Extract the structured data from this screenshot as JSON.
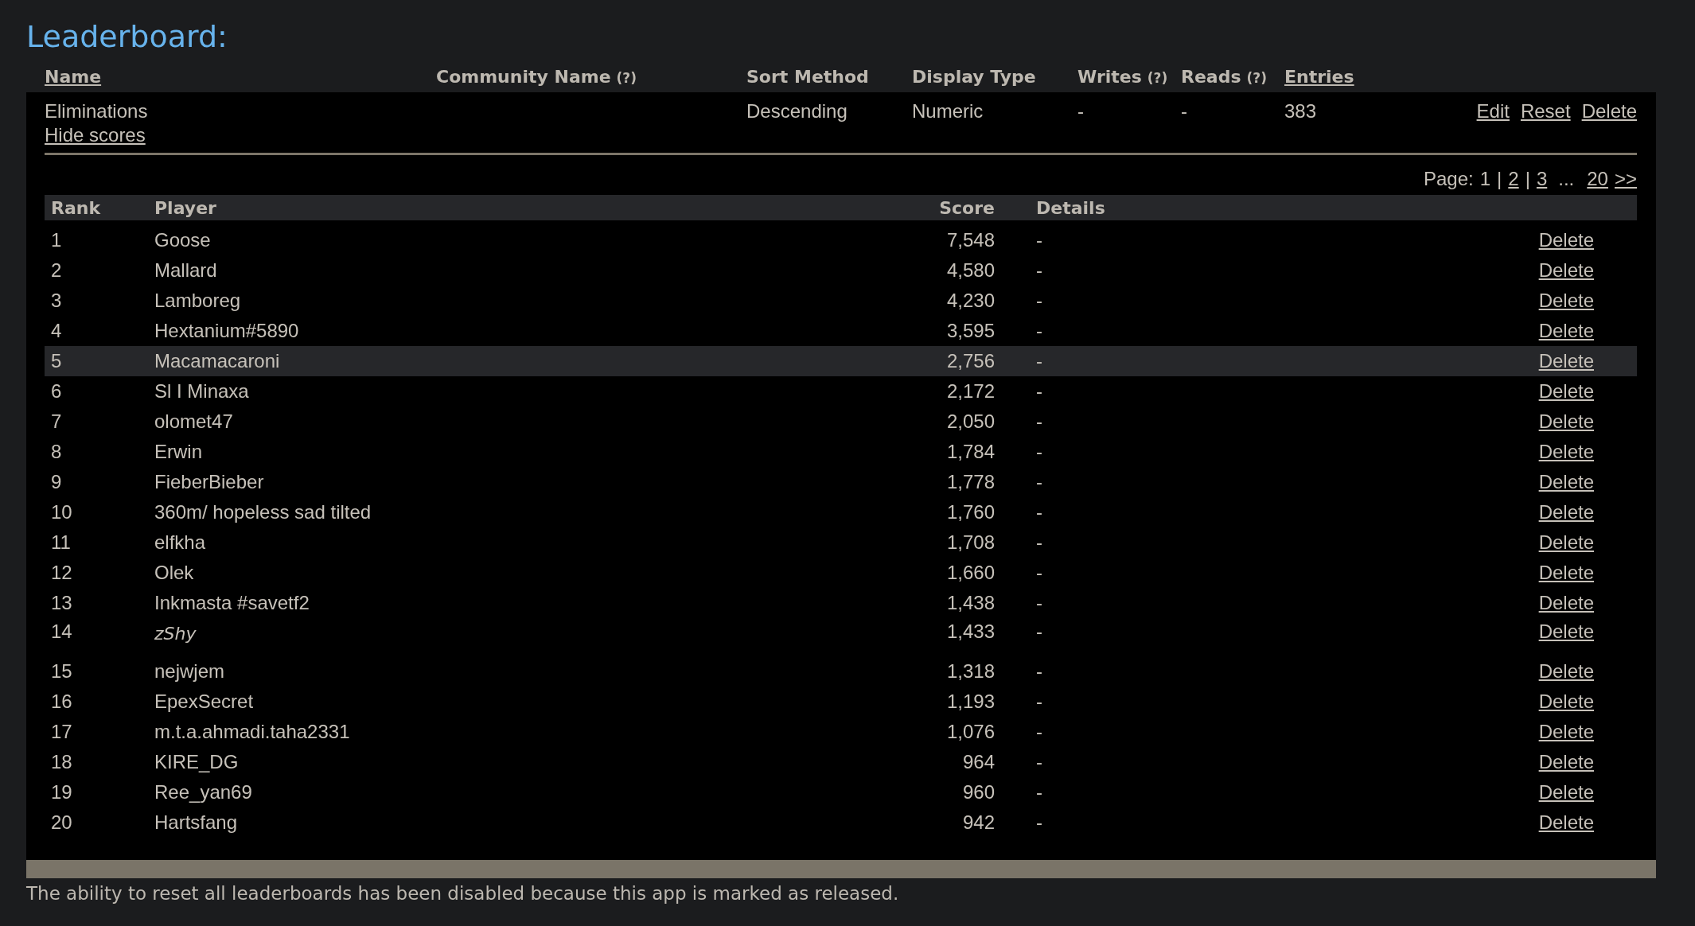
{
  "title": "Leaderboard:",
  "columns": [
    {
      "label": "Name",
      "link": true
    },
    {
      "label": "Community Name",
      "help": "(?)",
      "link": false
    },
    {
      "label": "Sort Method",
      "link": false
    },
    {
      "label": "Display Type",
      "link": false
    },
    {
      "label": "Writes",
      "help": "(?)",
      "link": false
    },
    {
      "label": "Reads",
      "help": "(?)",
      "link": false
    },
    {
      "label": "Entries",
      "link": true
    }
  ],
  "leaderboard": {
    "name": "Eliminations",
    "hide_link": "Hide scores",
    "sort_method": "Descending",
    "display_type": "Numeric",
    "writes": "-",
    "reads": "-",
    "entries": "383",
    "actions": [
      "Edit",
      "Reset",
      "Delete"
    ]
  },
  "pagination": {
    "label": "Page:",
    "current": "1",
    "separator": "|",
    "pages": [
      "2",
      "3"
    ],
    "ellipsis": "...",
    "last": "20",
    "next": ">>"
  },
  "score_columns": [
    "Rank",
    "Player",
    "Score",
    "Details"
  ],
  "rows": [
    {
      "rank": "1",
      "player": "Goose",
      "score": "7,548",
      "details": "-",
      "action": "Delete",
      "selected": false,
      "italic": false
    },
    {
      "rank": "2",
      "player": "Mallard",
      "score": "4,580",
      "details": "-",
      "action": "Delete",
      "selected": false,
      "italic": false
    },
    {
      "rank": "3",
      "player": "Lamboreg",
      "score": "4,230",
      "details": "-",
      "action": "Delete",
      "selected": false,
      "italic": false
    },
    {
      "rank": "4",
      "player": "Hextanium#5890",
      "score": "3,595",
      "details": "-",
      "action": "Delete",
      "selected": false,
      "italic": false
    },
    {
      "rank": "5",
      "player": "Macamacaroni",
      "score": "2,756",
      "details": "-",
      "action": "Delete",
      "selected": true,
      "italic": false
    },
    {
      "rank": "6",
      "player": "Sl I Minaxa",
      "score": "2,172",
      "details": "-",
      "action": "Delete",
      "selected": false,
      "italic": false
    },
    {
      "rank": "7",
      "player": "olomet47",
      "score": "2,050",
      "details": "-",
      "action": "Delete",
      "selected": false,
      "italic": false
    },
    {
      "rank": "8",
      "player": "Erwin",
      "score": "1,784",
      "details": "-",
      "action": "Delete",
      "selected": false,
      "italic": false
    },
    {
      "rank": "9",
      "player": "FieberBieber",
      "score": "1,778",
      "details": "-",
      "action": "Delete",
      "selected": false,
      "italic": false
    },
    {
      "rank": "10",
      "player": "360m/ hopeless sad tilted",
      "score": "1,760",
      "details": "-",
      "action": "Delete",
      "selected": false,
      "italic": false
    },
    {
      "rank": "11",
      "player": "elfkha",
      "score": "1,708",
      "details": "-",
      "action": "Delete",
      "selected": false,
      "italic": false
    },
    {
      "rank": "12",
      "player": "Olek",
      "score": "1,660",
      "details": "-",
      "action": "Delete",
      "selected": false,
      "italic": false
    },
    {
      "rank": "13",
      "player": "Inkmasta #savetf2",
      "score": "1,438",
      "details": "-",
      "action": "Delete",
      "selected": false,
      "italic": false
    },
    {
      "rank": "14",
      "player": "zShy",
      "score": "1,433",
      "details": "-",
      "action": "Delete",
      "selected": false,
      "italic": true
    },
    {
      "rank": "15",
      "player": "nejwjem",
      "score": "1,318",
      "details": "-",
      "action": "Delete",
      "selected": false,
      "italic": false
    },
    {
      "rank": "16",
      "player": "EpexSecret",
      "score": "1,193",
      "details": "-",
      "action": "Delete",
      "selected": false,
      "italic": false
    },
    {
      "rank": "17",
      "player": "m.t.a.ahmadi.taha2331",
      "score": "1,076",
      "details": "-",
      "action": "Delete",
      "selected": false,
      "italic": false
    },
    {
      "rank": "18",
      "player": "KIRE_DG",
      "score": "964",
      "details": "-",
      "action": "Delete",
      "selected": false,
      "italic": false
    },
    {
      "rank": "19",
      "player": "Ree_yan69",
      "score": "960",
      "details": "-",
      "action": "Delete",
      "selected": false,
      "italic": false
    },
    {
      "rank": "20",
      "player": "Hartsfang",
      "score": "942",
      "details": "-",
      "action": "Delete",
      "selected": false,
      "italic": false
    }
  ],
  "footer_note": "The ability to reset all leaderboards has been disabled because this app is marked as released."
}
